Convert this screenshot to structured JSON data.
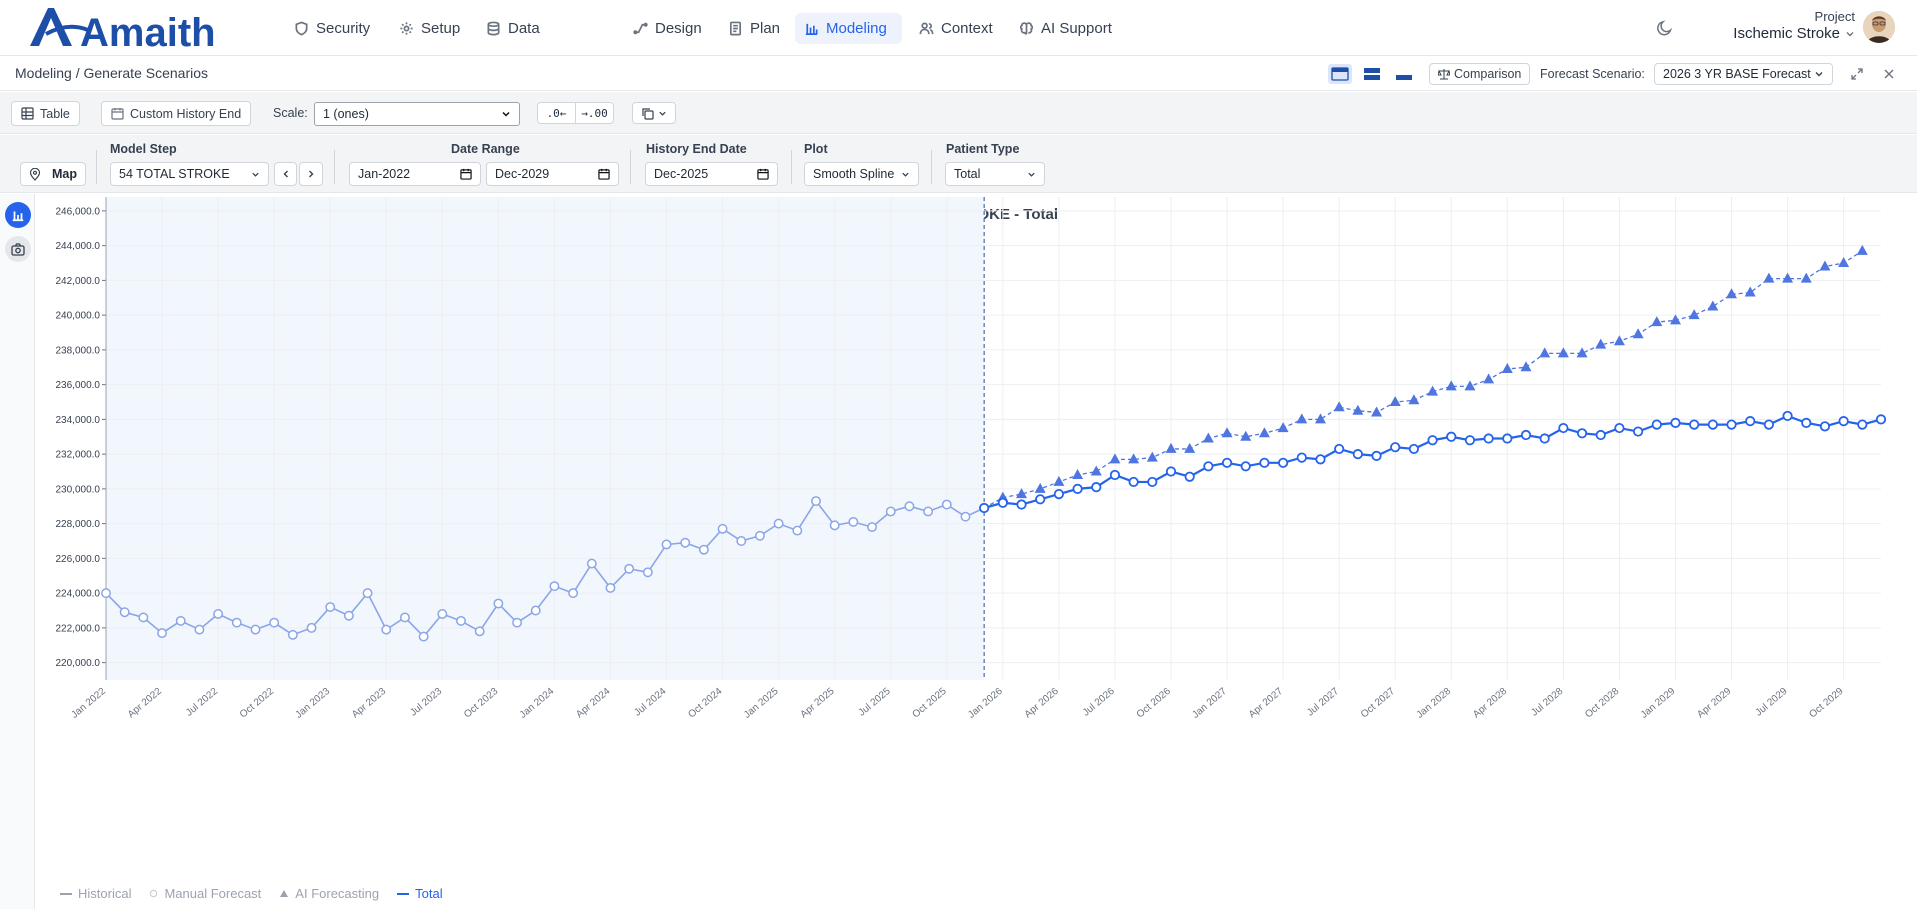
{
  "nav": {
    "logo_text": "Amaith",
    "items": [
      {
        "label": "Security",
        "icon": "shield-icon"
      },
      {
        "label": "Setup",
        "icon": "gear-icon"
      },
      {
        "label": "Data",
        "icon": "database-icon"
      },
      {
        "label": "Design",
        "icon": "flow-icon"
      },
      {
        "label": "Plan",
        "icon": "document-icon"
      },
      {
        "label": "Modeling",
        "icon": "bar-chart-icon",
        "active": true
      },
      {
        "label": "Context",
        "icon": "people-icon"
      },
      {
        "label": "AI Support",
        "icon": "brain-icon"
      }
    ],
    "project_label": "Project",
    "project_name": "Ischemic Stroke"
  },
  "breadcrumb": "Modeling / Generate Scenarios",
  "header": {
    "comparison_label": "Comparison",
    "forecast_scenario_label": "Forecast Scenario:",
    "forecast_scenario_value": "2026 3 YR BASE Forecast"
  },
  "toolbar": {
    "table_label": "Table",
    "custom_history_end_label": "Custom History End",
    "scale_label": "Scale:",
    "scale_value": "1 (ones)",
    "decrease_decimals": ".0←",
    "increase_decimals": "→.00"
  },
  "filters": {
    "map_label": "Map",
    "model_step_label": "Model Step",
    "model_step_value": "54 TOTAL STROKE",
    "date_range_label": "Date Range",
    "date_start": "Jan-2022",
    "date_end": "Dec-2029",
    "history_end_label": "History End Date",
    "history_end_value": "Dec-2025",
    "plot_label": "Plot",
    "plot_value": "Smooth Spline",
    "patient_type_label": "Patient Type",
    "patient_type_value": "Total"
  },
  "colors": {
    "accent": "#2563eb",
    "historical": "#8aa5e8",
    "ai": "#4f76e0",
    "history_shade": "#f2f6fd"
  },
  "chart_data": {
    "type": "line",
    "title": "TOTAL STROKE - Total",
    "ylim": [
      219000,
      246800
    ],
    "yticks": [
      220000,
      222000,
      224000,
      226000,
      228000,
      230000,
      232000,
      234000,
      236000,
      238000,
      240000,
      242000,
      244000,
      246000
    ],
    "ytick_labels": [
      "220,000.0",
      "222,000.0",
      "224,000.0",
      "226,000.0",
      "228,000.0",
      "230,000.0",
      "232,000.0",
      "234,000.0",
      "236,000.0",
      "238,000.0",
      "240,000.0",
      "242,000.0",
      "244,000.0",
      "246,000.0"
    ],
    "x_tick_labels": [
      "Jan 2022",
      "Apr 2022",
      "Jul 2022",
      "Oct 2022",
      "Jan 2023",
      "Apr 2023",
      "Jul 2023",
      "Oct 2023",
      "Jan 2024",
      "Apr 2024",
      "Jul 2024",
      "Oct 2024",
      "Jan 2025",
      "Apr 2025",
      "Jul 2025",
      "Oct 2025",
      "Jan 2026",
      "Apr 2026",
      "Jul 2026",
      "Oct 2026",
      "Jan 2027",
      "Apr 2027",
      "Jul 2027",
      "Oct 2027",
      "Jan 2028",
      "Apr 2028",
      "Jul 2028",
      "Oct 2028",
      "Jan 2029",
      "Apr 2029",
      "Jul 2029",
      "Oct 2029"
    ],
    "history_end": "Dec 2025",
    "grid": true,
    "legend_position": "bottom-left",
    "series": [
      {
        "name": "Historical",
        "start": "Jan 2022",
        "values": [
          224000,
          222900,
          222600,
          221700,
          222400,
          221900,
          222800,
          222300,
          221900,
          222300,
          221600,
          222000,
          223200,
          222700,
          224000,
          221900,
          222600,
          221500,
          222800,
          222400,
          221800,
          223400,
          222300,
          223000,
          224400,
          224000,
          225700,
          224300,
          225400,
          225200,
          226800,
          226900,
          226500,
          227700,
          227000,
          227300,
          228000,
          227600,
          229300,
          227900,
          228100,
          227800,
          228700,
          229000,
          228700,
          229100,
          228400,
          228900
        ]
      },
      {
        "name": "AI Forecasting",
        "start": "Jan 2026",
        "values": [
          229500,
          229700,
          230000,
          230400,
          230800,
          231000,
          231700,
          231700,
          231800,
          232300,
          232300,
          232900,
          233200,
          233000,
          233200,
          233500,
          234000,
          234000,
          234700,
          234500,
          234400,
          235000,
          235100,
          235600,
          235900,
          235900,
          236300,
          236900,
          237000,
          237800,
          237800,
          237800,
          238300,
          238500,
          238900,
          239600,
          239700,
          240000,
          240500,
          241200,
          241300,
          242100,
          242100,
          242100,
          242800,
          243000,
          243700
        ]
      },
      {
        "name": "Total",
        "start": "Dec 2025",
        "values": [
          228900,
          229200,
          229100,
          229400,
          229700,
          230000,
          230100,
          230800,
          230400,
          230400,
          231000,
          230700,
          231300,
          231500,
          231300,
          231500,
          231500,
          231800,
          231700,
          232300,
          232000,
          231900,
          232400,
          232300,
          232800,
          233000,
          232800,
          232900,
          232900,
          233100,
          232900,
          233500,
          233200,
          233100,
          233500,
          233300,
          233700,
          233800,
          233700,
          233700,
          233700,
          233900,
          233700,
          234200,
          233800,
          233600,
          233900,
          233700,
          234000
        ]
      }
    ],
    "legend": [
      "Historical",
      "Manual Forecast",
      "AI Forecasting",
      "Total"
    ]
  }
}
